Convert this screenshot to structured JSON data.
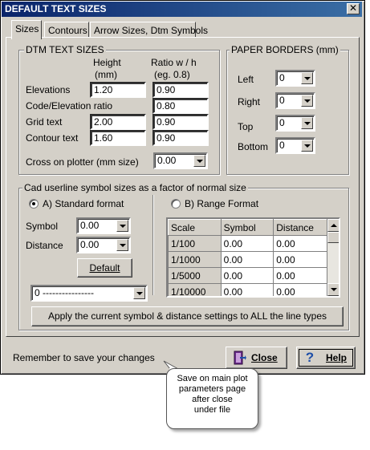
{
  "window": {
    "title": "DEFAULT TEXT SIZES",
    "close_glyph": "✕"
  },
  "tabs": [
    {
      "label": "Sizes",
      "active": true
    },
    {
      "label": "Contours",
      "active": false
    },
    {
      "label": "Arrow Sizes, Dtm Symbols",
      "active": false
    }
  ],
  "dtm": {
    "legend": "DTM TEXT SIZES",
    "height_header": "Height",
    "height_unit": "(mm)",
    "ratio_header": "Ratio w / h",
    "ratio_hint": "(eg. 0.8)",
    "rows": [
      {
        "label": "Elevations",
        "height": "1.20",
        "ratio": "0.90"
      },
      {
        "label": "Code/Elevation ratio",
        "height": "",
        "ratio": "0.80"
      },
      {
        "label": "Grid text",
        "height": "2.00",
        "ratio": "0.90"
      },
      {
        "label": "Contour text",
        "height": "1.60",
        "ratio": "0.90"
      }
    ],
    "cross_label": "Cross on plotter (mm size)",
    "cross_value": "0.00"
  },
  "paper": {
    "legend": "PAPER BORDERS (mm)",
    "left_label": "Left",
    "left_value": "0",
    "right_label": "Right",
    "right_value": "0",
    "top_label": "Top",
    "top_value": "0",
    "bottom_label": "Bottom",
    "bottom_value": "0"
  },
  "cad": {
    "legend": "Cad userline symbol sizes as a factor of normal size",
    "standard_label": "A) Standard format",
    "range_label": "B) Range Format",
    "symbol_label": "Symbol",
    "symbol_value": "0.00",
    "distance_label": "Distance",
    "distance_value": "0.00",
    "default_button": "Default",
    "linetype_value": "0 ----------------",
    "grid_headers": [
      "Scale",
      "Symbol",
      "Distance"
    ],
    "grid_rows": [
      [
        "1/100",
        "0.00",
        "0.00"
      ],
      [
        "1/1000",
        "0.00",
        "0.00"
      ],
      [
        "1/5000",
        "0.00",
        "0.00"
      ],
      [
        "1/10000",
        "0.00",
        "0.00"
      ]
    ],
    "apply_button": "Apply the current symbol & distance settings to ALL the line types"
  },
  "footer": {
    "reminder": "Remember to save your changes",
    "close_button": "Close",
    "help_button": "Help"
  },
  "callout": {
    "line1": "Save on main plot",
    "line2": "parameters page",
    "line3": "after close",
    "line4": "under file"
  }
}
